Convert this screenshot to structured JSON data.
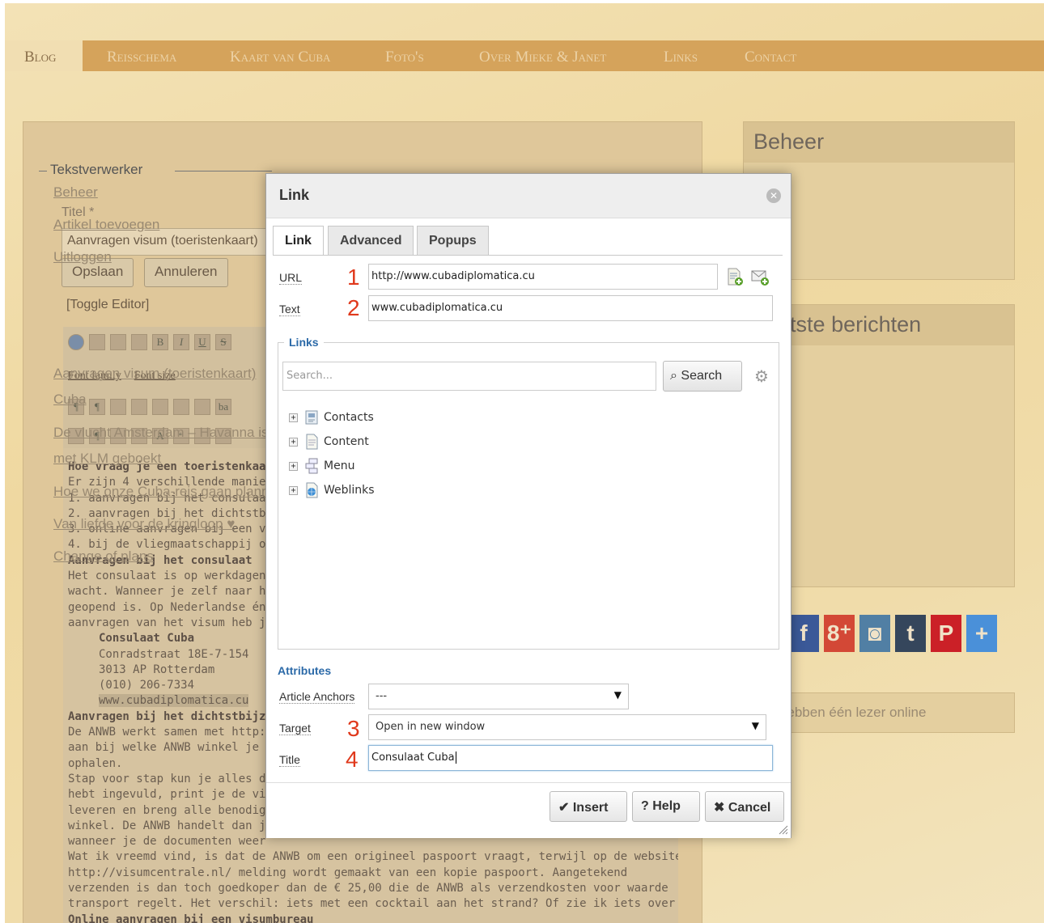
{
  "nav": {
    "items": [
      "Blog",
      "Reisschema",
      "Kaart van Cuba",
      "Foto's",
      "Over Mieke & Janet",
      "Links",
      "Contact"
    ]
  },
  "editor_form": {
    "legend": "Tekstverwerker",
    "title_label": "Titel *",
    "title_value": "Aanvragen visum (toeristenkaart)",
    "save_button": "Opslaan",
    "cancel_button": "Annuleren",
    "toggle_editor": "[Toggle Editor]",
    "font_family": "Font family",
    "font_size": "Font size",
    "content_lines": [
      {
        "text": "Hoe vraag je een toeristenkaart aan",
        "style": "b"
      },
      {
        "text": "Er zijn 4 verschillende manieren",
        "style": ""
      },
      {
        "text": "1. aanvragen bij het consulaat in",
        "style": ""
      },
      {
        "text": "2. aanvragen bij het dichtstbijzijn",
        "style": ""
      },
      {
        "text": "3. online aanvragen bij een visum",
        "style": ""
      },
      {
        "text": "4. bij de vliegmaatschappij of rei",
        "style": ""
      },
      {
        "text": "Aanvragen bij het consulaat",
        "style": "b"
      },
      {
        "text": "Het consulaat is op werkdagen op",
        "style": ""
      },
      {
        "text": "wacht. Wanneer je zelf naar het c",
        "style": ""
      },
      {
        "text": "geopend is. Op Nederlandse én C",
        "style": ""
      },
      {
        "text": "aanvragen van het visum heb je",
        "style": ""
      },
      {
        "text": "Consulaat Cuba",
        "style": "b ind"
      },
      {
        "text": "Conradstraat 18E-7-154",
        "style": "ind"
      },
      {
        "text": "3013 AP Rotterdam",
        "style": "ind"
      },
      {
        "text": "(010) 206-7334",
        "style": "ind"
      },
      {
        "text": "www.cubadiplomatica.cu",
        "style": "ind hl"
      },
      {
        "text": "Aanvragen bij het dichtstbijzij",
        "style": "b"
      },
      {
        "text": "De ANWB werkt samen met http:",
        "style": ""
      },
      {
        "text": "aan bij welke ANWB winkel je jou",
        "style": ""
      },
      {
        "text": "ophalen.",
        "style": ""
      },
      {
        "text": "Stap voor stap kun je alles doorr",
        "style": ""
      },
      {
        "text": "hebt ingevuld, print je de visuma",
        "style": ""
      },
      {
        "text": "leveren en breng alle benodigde",
        "style": ""
      },
      {
        "text": "winkel. De ANWB handelt dan jou",
        "style": ""
      },
      {
        "text": "wanneer je de documenten weer",
        "style": ""
      },
      {
        "text": "Wat ik vreemd vind, is dat de ANWB om een origineel paspoort vraagt, terwijl op de website van",
        "style": ""
      },
      {
        "text": "http://visumcentrale.nl/ melding wordt gemaakt van een kopie paspoort. Aangetekend",
        "style": ""
      },
      {
        "text": "verzenden is dan toch goedkoper dan de € 25,00 die de ANWB als verzendkosten voor waarde",
        "style": ""
      },
      {
        "text": "transport regelt. Het verschil: iets met een cocktail aan het strand? Of zie ik iets over het hoofd?",
        "style": ""
      },
      {
        "text": "Online aanvragen bij een visumbureau",
        "style": "b"
      }
    ]
  },
  "sidebar": {
    "beheer_title": "Beheer",
    "beheer_links": [
      "Beheer",
      "Artikel toevoegen",
      "Uitloggen"
    ],
    "recent_title": "Laatste berichten",
    "recent_links": [
      "Aanvragen visum (toeristenkaart)",
      "Cuba",
      "De vlucht Amsterdam – Havanna is",
      "met KLM geboekt",
      "Hoe we onze Cuba-reis gaan plannen",
      "Van liefde voor de kringloop ♥",
      "Change of plans"
    ],
    "online_text": "We hebben één lezer online",
    "social": [
      "f",
      "8⁺",
      "◙",
      "t",
      "P",
      "+"
    ]
  },
  "modal": {
    "title": "Link",
    "tabs": [
      "Link",
      "Advanced",
      "Popups"
    ],
    "url_label": "URL",
    "url_value": "http://www.cubadiplomatica.cu",
    "text_label": "Text",
    "text_value": "www.cubadiplomatica.cu",
    "links_legend": "Links",
    "search_placeholder": "Search...",
    "search_button": "Search",
    "tree": [
      "Contacts",
      "Content",
      "Menu",
      "Weblinks"
    ],
    "attributes_legend": "Attributes",
    "anchors_label": "Article Anchors",
    "anchors_value": "---",
    "target_label": "Target",
    "target_value": "Open in new window",
    "title_label": "Title",
    "title_value": "Consulaat Cuba",
    "numbers": [
      "1",
      "2",
      "3",
      "4"
    ],
    "insert_button": "Insert",
    "help_button": "Help",
    "cancel_button": "Cancel"
  },
  "colors": {
    "accent_blue": "#2c6aa8",
    "annotation_red": "#e0391c",
    "nav_bar": "#d5a35b"
  }
}
